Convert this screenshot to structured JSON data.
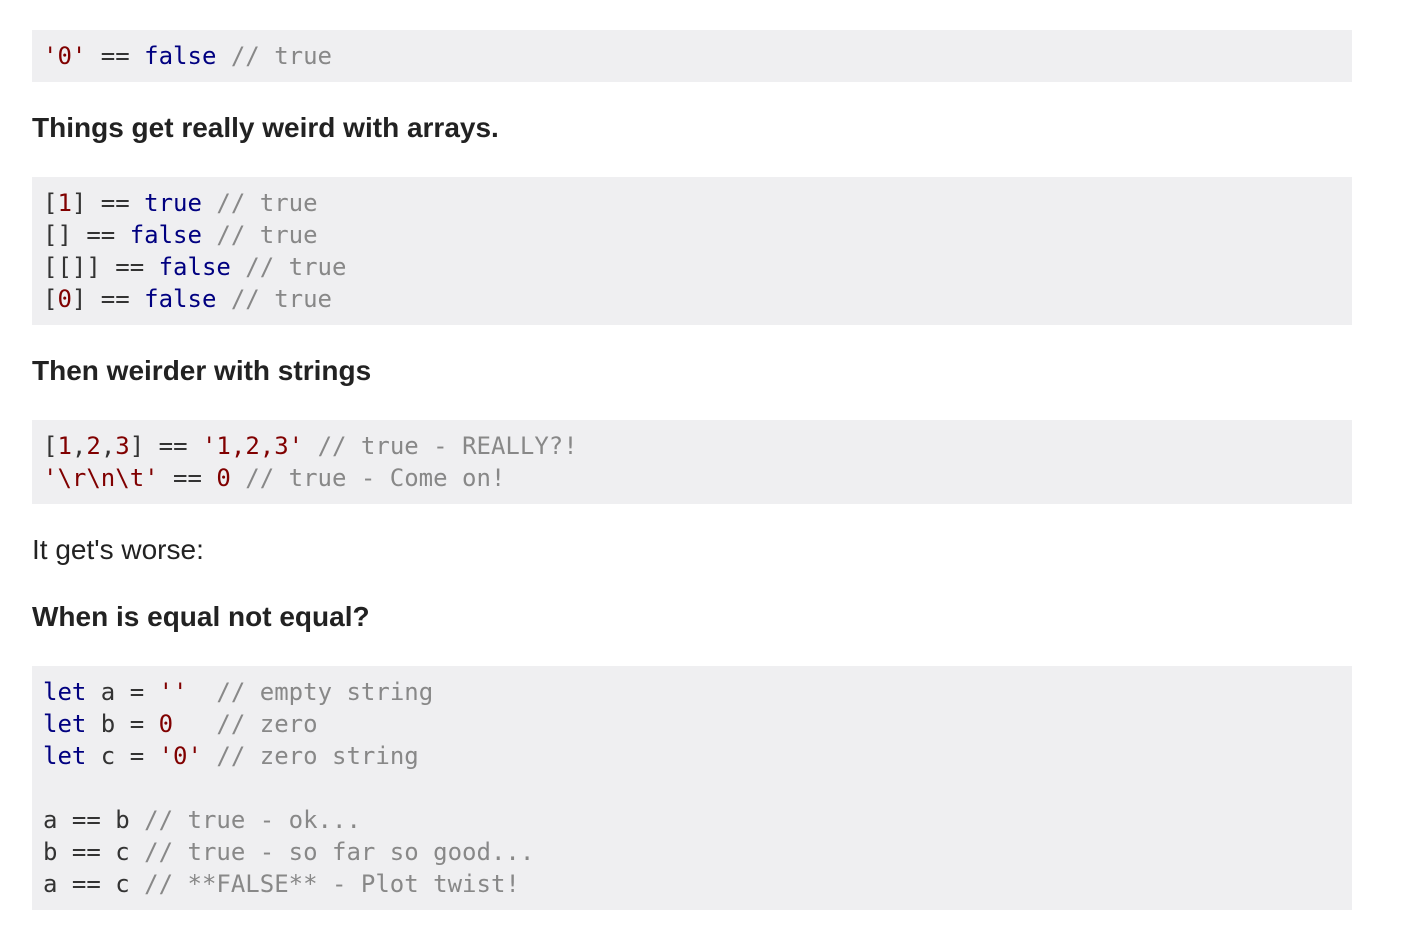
{
  "code_block_1": {
    "lines": [
      [
        {
          "t": "str",
          "v": "'0'"
        },
        {
          "t": "pl",
          "v": " == "
        },
        {
          "t": "kw",
          "v": "false"
        },
        {
          "t": "cmt",
          "v": " // true"
        }
      ]
    ]
  },
  "heading_arrays": "Things get really weird with arrays.",
  "code_block_2": {
    "lines": [
      [
        {
          "t": "pl",
          "v": "["
        },
        {
          "t": "num",
          "v": "1"
        },
        {
          "t": "pl",
          "v": "] == "
        },
        {
          "t": "kw",
          "v": "true"
        },
        {
          "t": "cmt",
          "v": " // true"
        }
      ],
      [
        {
          "t": "pl",
          "v": "[] == "
        },
        {
          "t": "kw",
          "v": "false"
        },
        {
          "t": "cmt",
          "v": " // true"
        }
      ],
      [
        {
          "t": "pl",
          "v": "[[]] == "
        },
        {
          "t": "kw",
          "v": "false"
        },
        {
          "t": "cmt",
          "v": " // true"
        }
      ],
      [
        {
          "t": "pl",
          "v": "["
        },
        {
          "t": "num",
          "v": "0"
        },
        {
          "t": "pl",
          "v": "] == "
        },
        {
          "t": "kw",
          "v": "false"
        },
        {
          "t": "cmt",
          "v": " // true"
        }
      ]
    ]
  },
  "heading_strings": "Then weirder with strings",
  "code_block_3": {
    "lines": [
      [
        {
          "t": "pl",
          "v": "["
        },
        {
          "t": "num",
          "v": "1"
        },
        {
          "t": "pl",
          "v": ","
        },
        {
          "t": "num",
          "v": "2"
        },
        {
          "t": "pl",
          "v": ","
        },
        {
          "t": "num",
          "v": "3"
        },
        {
          "t": "pl",
          "v": "] == "
        },
        {
          "t": "str",
          "v": "'1,2,3'"
        },
        {
          "t": "cmt",
          "v": " // true - REALLY?!"
        }
      ],
      [
        {
          "t": "str",
          "v": "'\\r\\n\\t'"
        },
        {
          "t": "pl",
          "v": " == "
        },
        {
          "t": "num",
          "v": "0"
        },
        {
          "t": "cmt",
          "v": " // true - Come on!"
        }
      ]
    ]
  },
  "paragraph_worse": "It get's worse:",
  "heading_equal": "When is equal not equal?",
  "code_block_4": {
    "lines": [
      [
        {
          "t": "kw",
          "v": "let"
        },
        {
          "t": "pl",
          "v": " a = "
        },
        {
          "t": "str",
          "v": "''"
        },
        {
          "t": "pl",
          "v": "  "
        },
        {
          "t": "cmt",
          "v": "// empty string"
        }
      ],
      [
        {
          "t": "kw",
          "v": "let"
        },
        {
          "t": "pl",
          "v": " b = "
        },
        {
          "t": "num",
          "v": "0"
        },
        {
          "t": "pl",
          "v": "   "
        },
        {
          "t": "cmt",
          "v": "// zero"
        }
      ],
      [
        {
          "t": "kw",
          "v": "let"
        },
        {
          "t": "pl",
          "v": " c = "
        },
        {
          "t": "str",
          "v": "'0'"
        },
        {
          "t": "pl",
          "v": " "
        },
        {
          "t": "cmt",
          "v": "// zero string"
        }
      ],
      [],
      [
        {
          "t": "pl",
          "v": "a == b "
        },
        {
          "t": "cmt",
          "v": "// true - ok..."
        }
      ],
      [
        {
          "t": "pl",
          "v": "b == c "
        },
        {
          "t": "cmt",
          "v": "// true - so far so good..."
        }
      ],
      [
        {
          "t": "pl",
          "v": "a == c "
        },
        {
          "t": "cmt",
          "v": "// **FALSE** - Plot twist!"
        }
      ]
    ]
  },
  "colors": {
    "keyword": "#000080",
    "string": "#800000",
    "number": "#800000",
    "comment": "#888888",
    "plain": "#333333",
    "code_background": "#efeff1"
  }
}
